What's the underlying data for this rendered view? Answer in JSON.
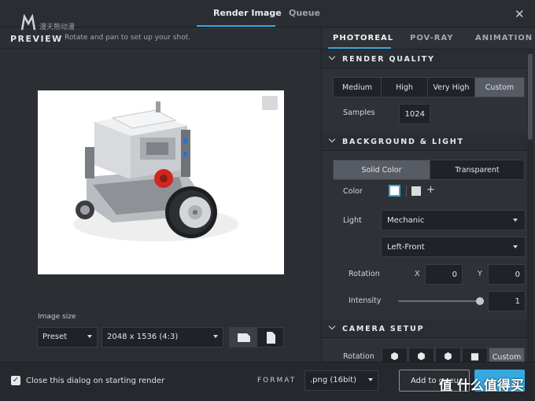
{
  "window": {
    "tabs": [
      "Render Image",
      "Queue"
    ],
    "close_glyph": "✕",
    "logo_text": "漫天熊动漫"
  },
  "preview": {
    "title": "PREVIEW",
    "subtitle": "Rotate and pan to set up your shot."
  },
  "image_size": {
    "label": "Image size",
    "preset": "Preset",
    "resolution": "2048 x 1536 (4:3)"
  },
  "bottom": {
    "checkbox_checked": true,
    "checkbox_label": "Close this dialog on starting render",
    "format_label": "FORMAT",
    "format_value": ".png (16bit)",
    "add_button": "Add to queue",
    "watermark": "值 什么值得买"
  },
  "panel": {
    "tabs": [
      "PHOTOREAL",
      "POV-RAY",
      "ANIMATION"
    ],
    "render_quality": {
      "title": "RENDER QUALITY",
      "options": [
        "Medium",
        "High",
        "Very High",
        "Custom"
      ],
      "selected": "Custom",
      "samples_label": "Samples",
      "samples_value": "1024"
    },
    "background_light": {
      "title": "BACKGROUND & LIGHT",
      "options": [
        "Solid Color",
        "Transparent"
      ],
      "selected": "Solid Color",
      "color_label": "Color",
      "light_label": "Light",
      "light_value": "Mechanic",
      "light_direction": "Left-Front",
      "rotation_label": "Rotation",
      "x_label": "X",
      "x_value": "0",
      "y_label": "Y",
      "y_value": "0",
      "intensity_label": "Intensity",
      "intensity_value": "1"
    },
    "camera_setup": {
      "title": "CAMERA SETUP",
      "rotation_label": "Rotation",
      "custom_label": "Custom"
    }
  },
  "colors": {
    "accent": "#36a9e1",
    "background": "#2b2e33",
    "panel": "#2e3136"
  }
}
